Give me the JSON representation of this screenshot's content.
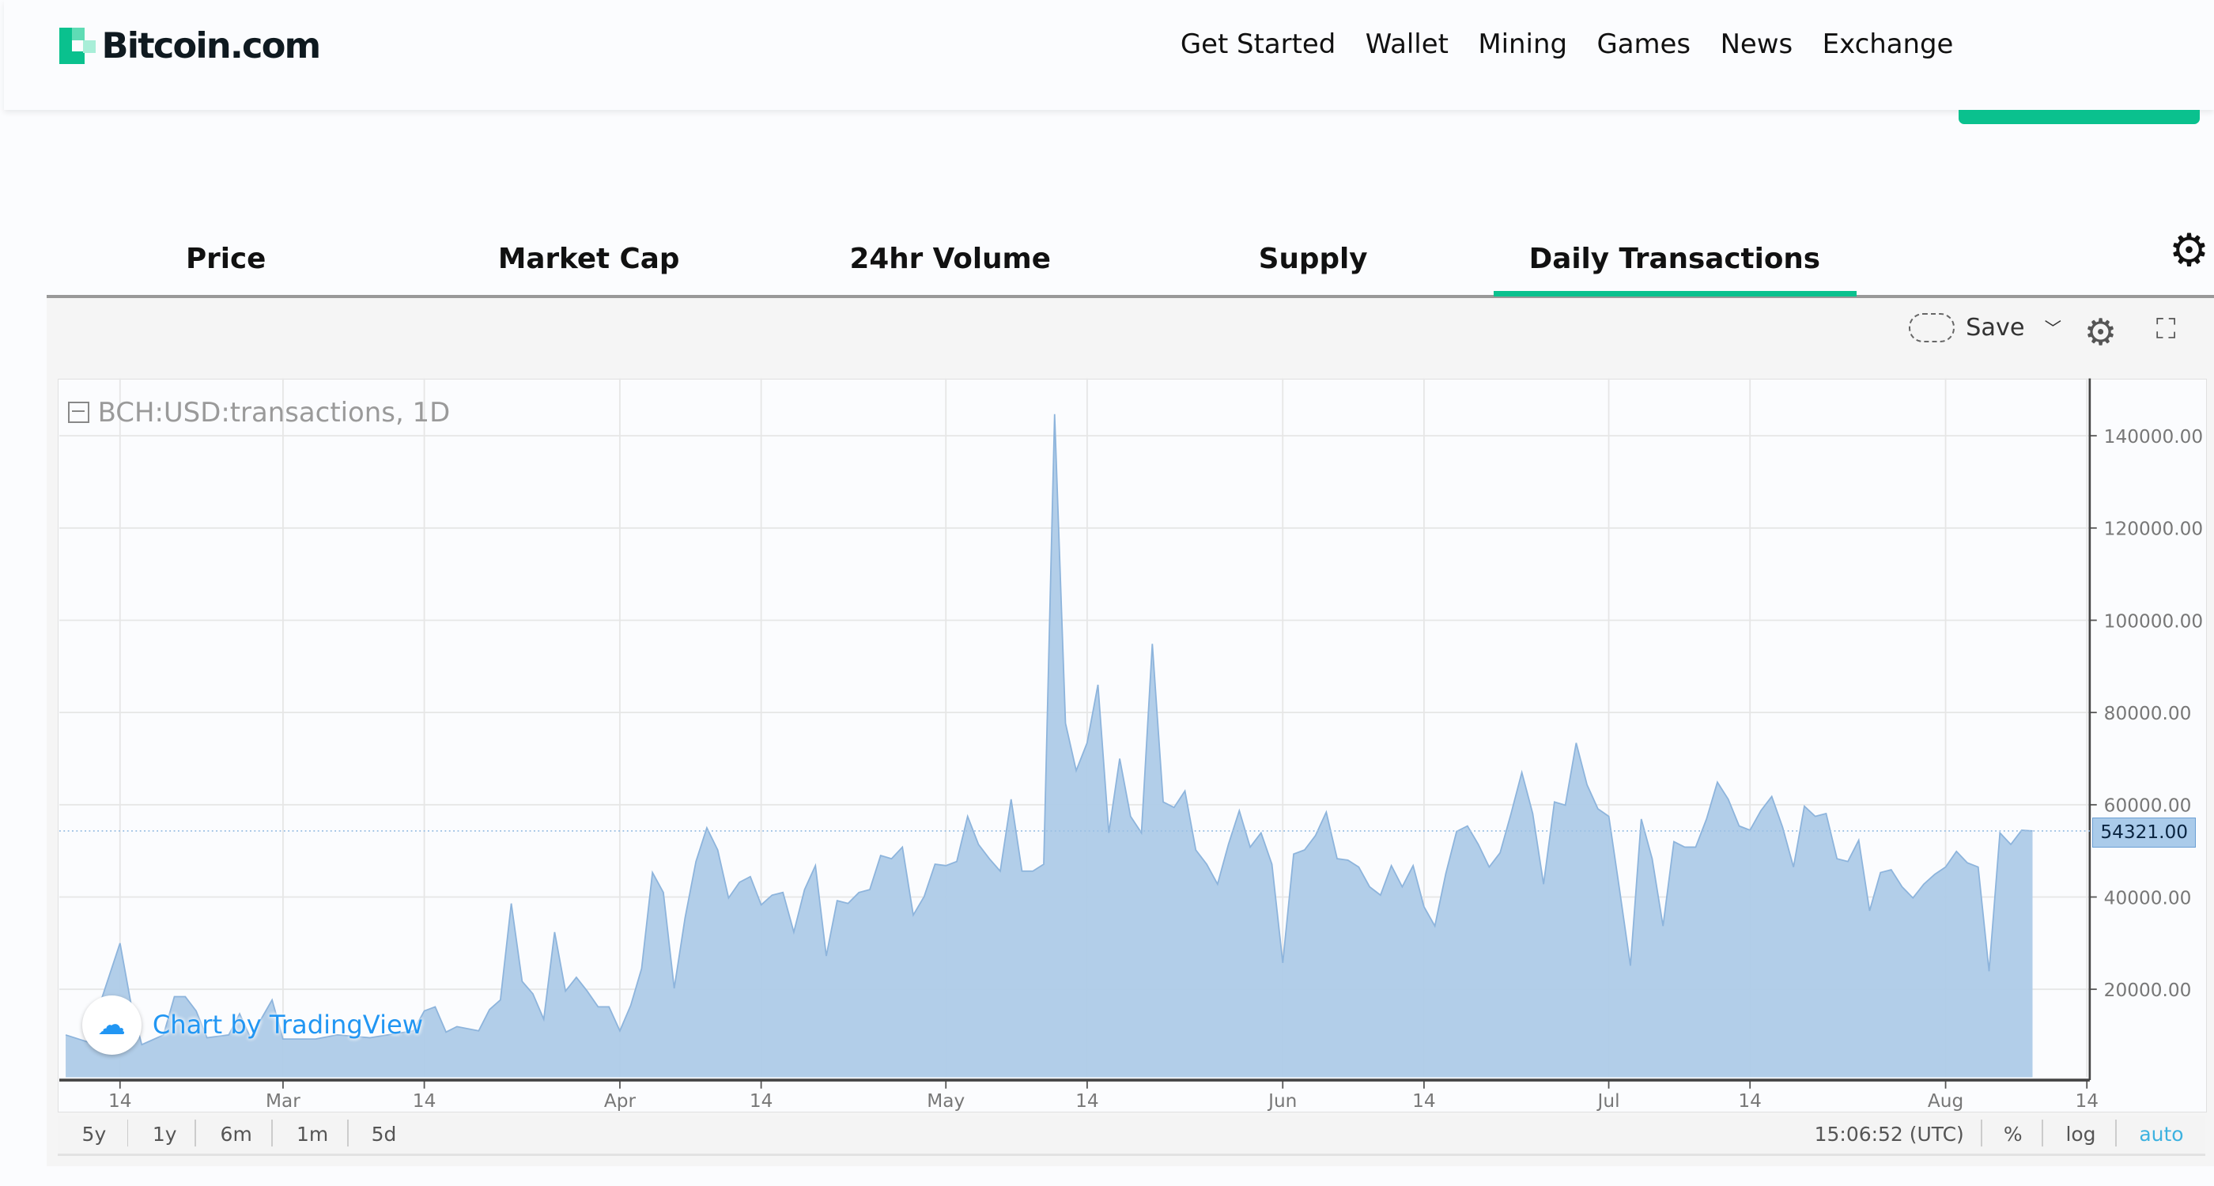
{
  "header": {
    "logo_text": "Bitcoin.com",
    "nav": [
      "Get Started",
      "Wallet",
      "Mining",
      "Games",
      "News",
      "Exchange"
    ]
  },
  "tabs": [
    {
      "label": "Price",
      "active": false
    },
    {
      "label": "Market Cap",
      "active": false
    },
    {
      "label": "24hr Volume",
      "active": false
    },
    {
      "label": "Supply",
      "active": false
    },
    {
      "label": "Daily Transactions",
      "active": true
    }
  ],
  "toolbar": {
    "save_label": "Save"
  },
  "colors": {
    "brand_green": "#0ac18e",
    "area_fill": "#aecbe8",
    "area_line": "#8db4dc",
    "auto_blue": "#3db2e0"
  },
  "chart": {
    "legend": "BCH:USD:transactions, 1D",
    "watermark": "Chart by TradingView",
    "current_value_label": "54321.00",
    "time": "15:06:52 (UTC)",
    "ranges": [
      "5y",
      "1y",
      "6m",
      "1m",
      "5d"
    ],
    "scale_options": {
      "percent": "%",
      "log": "log",
      "auto": "auto"
    }
  },
  "chart_data": {
    "type": "area",
    "title": "BCH:USD:transactions, 1D",
    "y_ticks": [
      "140000.00",
      "120000.00",
      "100000.00",
      "80000.00",
      "60000.00",
      "40000.00",
      "20000.00"
    ],
    "x_ticks": [
      {
        "label": "14",
        "date": "2019-02-14"
      },
      {
        "label": "Mar",
        "date": "2019-03-01"
      },
      {
        "label": "14",
        "date": "2019-03-14"
      },
      {
        "label": "Apr",
        "date": "2019-04-01"
      },
      {
        "label": "14",
        "date": "2019-04-14"
      },
      {
        "label": "May",
        "date": "2019-05-01"
      },
      {
        "label": "14",
        "date": "2019-05-14"
      },
      {
        "label": "Jun",
        "date": "2019-06-01"
      },
      {
        "label": "14",
        "date": "2019-06-14"
      },
      {
        "label": "Jul",
        "date": "2019-07-01"
      },
      {
        "label": "14",
        "date": "2019-07-14"
      },
      {
        "label": "Aug",
        "date": "2019-08-01"
      },
      {
        "label": "14",
        "date": "2019-08-14"
      }
    ],
    "ylim": [
      0,
      150000
    ],
    "grid": true,
    "points": [
      [
        "2019-02-09",
        10100
      ],
      [
        "2019-02-11",
        8600
      ],
      [
        "2019-02-14",
        30000
      ],
      [
        "2019-02-15",
        17000
      ],
      [
        "2019-02-16",
        8000
      ],
      [
        "2019-02-18",
        10100
      ],
      [
        "2019-02-19",
        18400
      ],
      [
        "2019-02-20",
        18400
      ],
      [
        "2019-02-21",
        15300
      ],
      [
        "2019-02-22",
        9500
      ],
      [
        "2019-02-24",
        10100
      ],
      [
        "2019-02-25",
        14700
      ],
      [
        "2019-02-26",
        9500
      ],
      [
        "2019-02-28",
        17700
      ],
      [
        "2019-03-01",
        9200
      ],
      [
        "2019-03-04",
        9200
      ],
      [
        "2019-03-06",
        10100
      ],
      [
        "2019-03-09",
        9500
      ],
      [
        "2019-03-13",
        11000
      ],
      [
        "2019-03-14",
        15300
      ],
      [
        "2019-03-15",
        16200
      ],
      [
        "2019-03-16",
        10700
      ],
      [
        "2019-03-17",
        11900
      ],
      [
        "2019-03-19",
        11000
      ],
      [
        "2019-03-20",
        15600
      ],
      [
        "2019-03-21",
        17700
      ],
      [
        "2019-03-22",
        38600
      ],
      [
        "2019-03-23",
        21700
      ],
      [
        "2019-03-24",
        19000
      ],
      [
        "2019-03-25",
        13500
      ],
      [
        "2019-03-26",
        32400
      ],
      [
        "2019-03-27",
        19600
      ],
      [
        "2019-03-28",
        22600
      ],
      [
        "2019-03-29",
        19600
      ],
      [
        "2019-03-30",
        16200
      ],
      [
        "2019-03-31",
        16200
      ],
      [
        "2019-04-01",
        11000
      ],
      [
        "2019-04-02",
        16500
      ],
      [
        "2019-04-03",
        24500
      ],
      [
        "2019-04-04",
        45300
      ],
      [
        "2019-04-05",
        41000
      ],
      [
        "2019-04-06",
        20200
      ],
      [
        "2019-04-07",
        35500
      ],
      [
        "2019-04-08",
        47700
      ],
      [
        "2019-04-09",
        55000
      ],
      [
        "2019-04-10",
        50200
      ],
      [
        "2019-04-11",
        39800
      ],
      [
        "2019-04-12",
        43200
      ],
      [
        "2019-04-13",
        44400
      ],
      [
        "2019-04-14",
        38300
      ],
      [
        "2019-04-15",
        40400
      ],
      [
        "2019-04-16",
        41000
      ],
      [
        "2019-04-17",
        32400
      ],
      [
        "2019-04-18",
        41600
      ],
      [
        "2019-04-19",
        46800
      ],
      [
        "2019-04-20",
        27200
      ],
      [
        "2019-04-21",
        39200
      ],
      [
        "2019-04-22",
        38600
      ],
      [
        "2019-04-23",
        41000
      ],
      [
        "2019-04-24",
        41600
      ],
      [
        "2019-04-25",
        49000
      ],
      [
        "2019-04-26",
        48300
      ],
      [
        "2019-04-27",
        50800
      ],
      [
        "2019-04-28",
        36100
      ],
      [
        "2019-04-29",
        40100
      ],
      [
        "2019-04-30",
        47100
      ],
      [
        "2019-05-01",
        46800
      ],
      [
        "2019-05-02",
        47700
      ],
      [
        "2019-05-03",
        57500
      ],
      [
        "2019-05-04",
        51400
      ],
      [
        "2019-05-05",
        48300
      ],
      [
        "2019-05-06",
        45600
      ],
      [
        "2019-05-07",
        61200
      ],
      [
        "2019-05-08",
        45600
      ],
      [
        "2019-05-09",
        45600
      ],
      [
        "2019-05-10",
        47100
      ],
      [
        "2019-05-11",
        144700
      ],
      [
        "2019-05-12",
        77700
      ],
      [
        "2019-05-13",
        67400
      ],
      [
        "2019-05-14",
        73400
      ],
      [
        "2019-05-15",
        86000
      ],
      [
        "2019-05-16",
        53900
      ],
      [
        "2019-05-17",
        70000
      ],
      [
        "2019-05-18",
        57500
      ],
      [
        "2019-05-19",
        53900
      ],
      [
        "2019-05-20",
        94900
      ],
      [
        "2019-05-21",
        60600
      ],
      [
        "2019-05-22",
        59400
      ],
      [
        "2019-05-23",
        63000
      ],
      [
        "2019-05-24",
        50200
      ],
      [
        "2019-05-25",
        47100
      ],
      [
        "2019-05-26",
        42800
      ],
      [
        "2019-05-27",
        51400
      ],
      [
        "2019-05-28",
        58700
      ],
      [
        "2019-05-29",
        50800
      ],
      [
        "2019-05-30",
        53900
      ],
      [
        "2019-05-31",
        47100
      ],
      [
        "2019-06-01",
        25700
      ],
      [
        "2019-06-02",
        49300
      ],
      [
        "2019-06-03",
        50200
      ],
      [
        "2019-06-04",
        53300
      ],
      [
        "2019-06-05",
        58400
      ],
      [
        "2019-06-06",
        48300
      ],
      [
        "2019-06-07",
        48000
      ],
      [
        "2019-06-08",
        46500
      ],
      [
        "2019-06-09",
        42200
      ],
      [
        "2019-06-10",
        40400
      ],
      [
        "2019-06-11",
        46800
      ],
      [
        "2019-06-12",
        42200
      ],
      [
        "2019-06-13",
        46800
      ],
      [
        "2019-06-14",
        37900
      ],
      [
        "2019-06-15",
        33700
      ],
      [
        "2019-06-16",
        45000
      ],
      [
        "2019-06-17",
        54200
      ],
      [
        "2019-06-18",
        55400
      ],
      [
        "2019-06-19",
        51400
      ],
      [
        "2019-06-20",
        46500
      ],
      [
        "2019-06-21",
        49600
      ],
      [
        "2019-06-22",
        58000
      ],
      [
        "2019-06-23",
        67000
      ],
      [
        "2019-06-24",
        58100
      ],
      [
        "2019-06-25",
        42800
      ],
      [
        "2019-06-26",
        60600
      ],
      [
        "2019-06-27",
        59900
      ],
      [
        "2019-06-28",
        73400
      ],
      [
        "2019-06-29",
        64300
      ],
      [
        "2019-06-30",
        59100
      ],
      [
        "2019-07-01",
        57500
      ],
      [
        "2019-07-02",
        41600
      ],
      [
        "2019-07-03",
        25100
      ],
      [
        "2019-07-04",
        56900
      ],
      [
        "2019-07-05",
        48300
      ],
      [
        "2019-07-06",
        33700
      ],
      [
        "2019-07-07",
        52000
      ],
      [
        "2019-07-08",
        50800
      ],
      [
        "2019-07-09",
        50800
      ],
      [
        "2019-07-10",
        56900
      ],
      [
        "2019-07-11",
        64900
      ],
      [
        "2019-07-12",
        61200
      ],
      [
        "2019-07-13",
        55400
      ],
      [
        "2019-07-14",
        54500
      ],
      [
        "2019-07-15",
        58700
      ],
      [
        "2019-07-16",
        61800
      ],
      [
        "2019-07-17",
        55100
      ],
      [
        "2019-07-18",
        46500
      ],
      [
        "2019-07-19",
        59700
      ],
      [
        "2019-07-20",
        57500
      ],
      [
        "2019-07-21",
        58100
      ],
      [
        "2019-07-22",
        48300
      ],
      [
        "2019-07-23",
        47700
      ],
      [
        "2019-07-24",
        52300
      ],
      [
        "2019-07-25",
        37000
      ],
      [
        "2019-07-26",
        45300
      ],
      [
        "2019-07-27",
        45900
      ],
      [
        "2019-07-28",
        42200
      ],
      [
        "2019-07-29",
        39800
      ],
      [
        "2019-07-30",
        42800
      ],
      [
        "2019-07-31",
        44900
      ],
      [
        "2019-08-01",
        46500
      ],
      [
        "2019-08-02",
        49900
      ],
      [
        "2019-08-03",
        47400
      ],
      [
        "2019-08-04",
        46500
      ],
      [
        "2019-08-05",
        23900
      ],
      [
        "2019-08-06",
        53900
      ],
      [
        "2019-08-07",
        51400
      ],
      [
        "2019-08-08",
        54500
      ],
      [
        "2019-08-09",
        54321
      ]
    ]
  }
}
